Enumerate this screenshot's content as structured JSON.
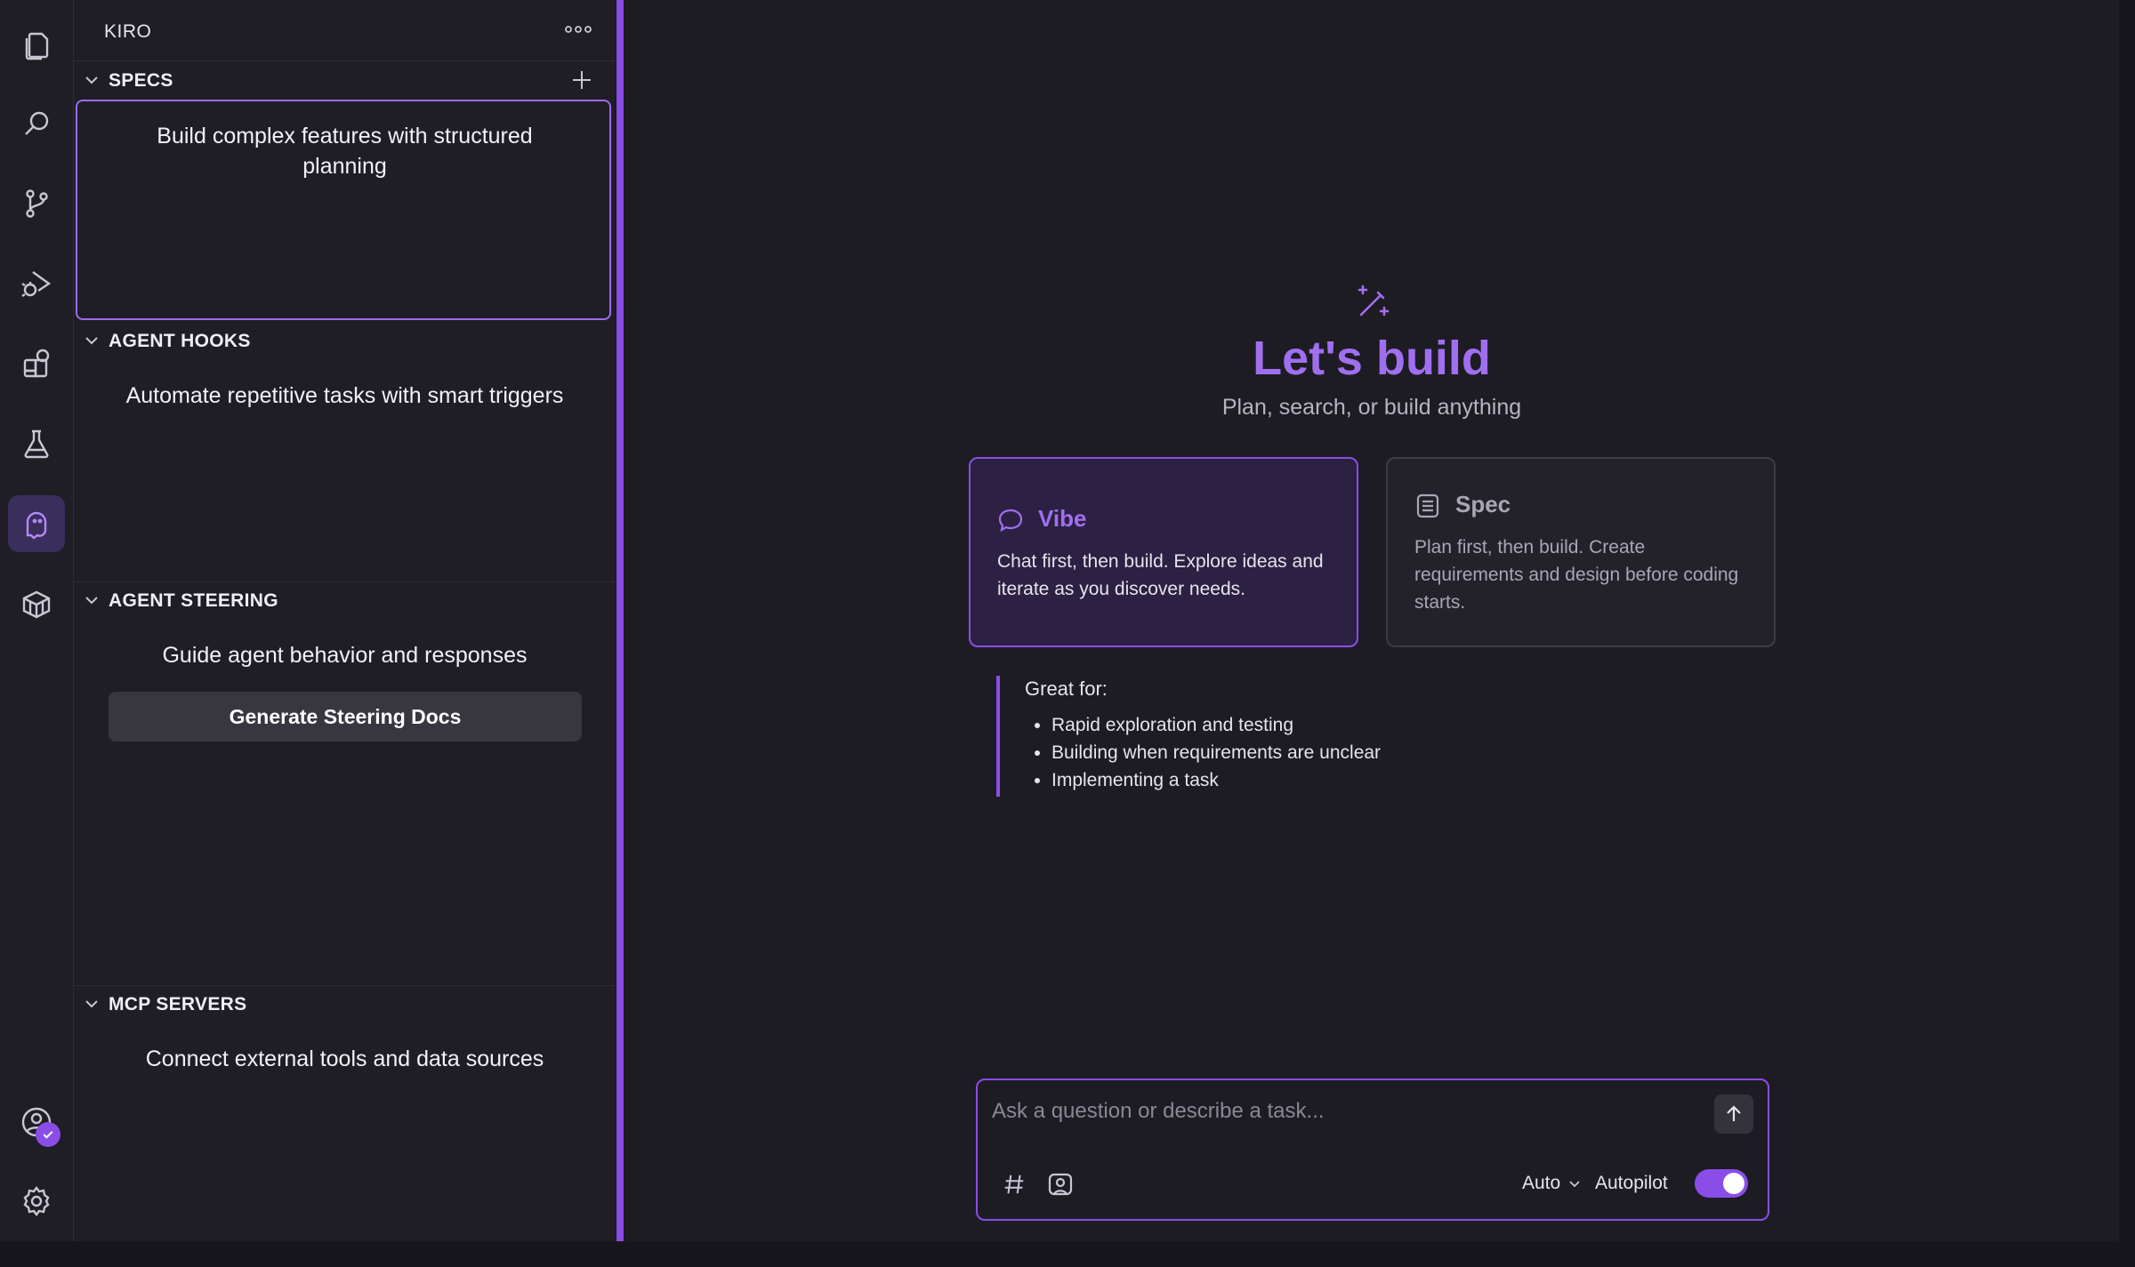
{
  "activity_bar": {
    "items": [
      "explorer-icon",
      "search-icon",
      "source-control-icon",
      "run-debug-icon",
      "extensions-icon",
      "testing-icon",
      "kiro-ghost-icon",
      "package-icon"
    ],
    "bottom": [
      "account-icon",
      "settings-gear-icon"
    ]
  },
  "sidebar": {
    "title": "KIRO",
    "sections": {
      "specs": {
        "label": "SPECS",
        "description": "Build complex features with structured planning"
      },
      "hooks": {
        "label": "AGENT HOOKS",
        "description": "Automate repetitive tasks with smart triggers"
      },
      "steering": {
        "label": "AGENT STEERING",
        "description": "Guide agent behavior and responses",
        "button": "Generate Steering Docs"
      },
      "mcp": {
        "label": "MCP SERVERS",
        "description": "Connect external tools and data sources"
      }
    }
  },
  "main": {
    "title": "Let's build",
    "subtitle": "Plan, search, or build anything",
    "modes": {
      "vibe": {
        "title": "Vibe",
        "description": "Chat first, then build. Explore ideas and iterate as you discover needs."
      },
      "spec": {
        "title": "Spec",
        "description": "Plan first, then build. Create requirements and design before coding starts."
      }
    },
    "great_for": {
      "title": "Great for:",
      "items": [
        "Rapid exploration and testing",
        "Building when requirements are unclear",
        "Implementing a task"
      ]
    },
    "input": {
      "placeholder": "Ask a question or describe a task...",
      "model": "Auto",
      "autopilot_label": "Autopilot",
      "autopilot_on": true
    }
  },
  "colors": {
    "accent": "#8b4de8",
    "title": "#a06ff0"
  }
}
